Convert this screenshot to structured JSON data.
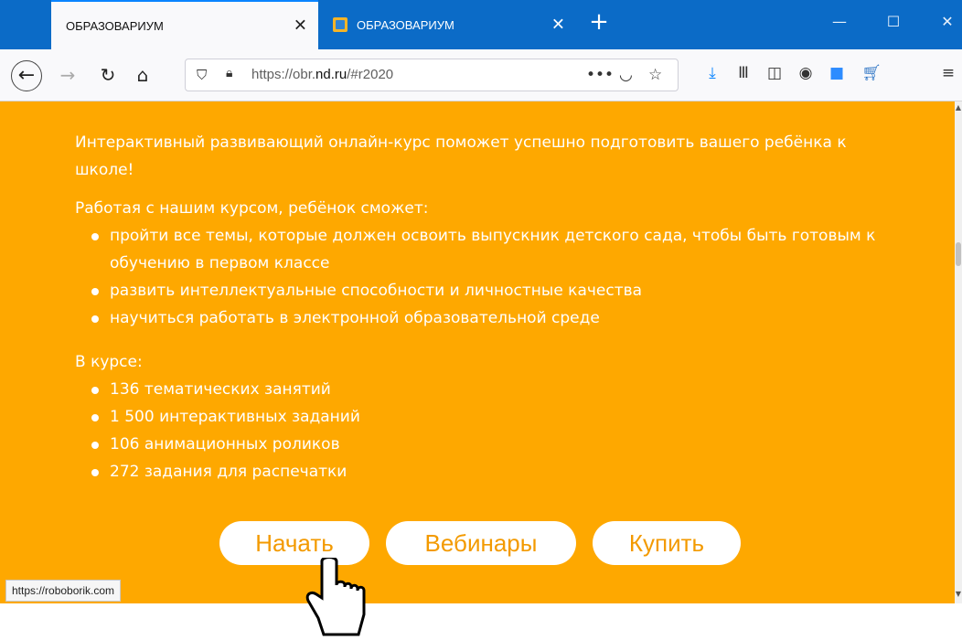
{
  "browser": {
    "tabs": [
      {
        "title": "ОБРАЗОВАРИУМ",
        "active": true
      },
      {
        "title": "ОБРАЗОВАРИУМ",
        "active": false
      }
    ],
    "url_prefix": "https://obr.",
    "url_domain": "nd.ru",
    "url_suffix": "/#r2020",
    "status_link": "https://roboborik.com",
    "accent": "#0b6bc7"
  },
  "page": {
    "background": "#fea800",
    "intro": "Интерактивный развивающий онлайн-курс поможет успешно подготовить вашего ребёнка к школе!",
    "skills_heading": "Работая с нашим курсом, ребёнок сможет:",
    "skills": [
      "пройти все темы, которые должен освоить выпускник детского сада, чтобы быть готовым к обучению в первом классе",
      "развить интеллектуальные способности и личностные качества",
      "научиться работать в электронной образовательной среде"
    ],
    "course_heading": "В курсе:",
    "course_items": [
      "136 тематических занятий",
      "1 500 интерактивных заданий",
      "106 анимационных роликов",
      "272 задания для распечатки"
    ],
    "buttons": {
      "start": "Начать",
      "webinars": "Вебинары",
      "buy": "Купить"
    }
  }
}
